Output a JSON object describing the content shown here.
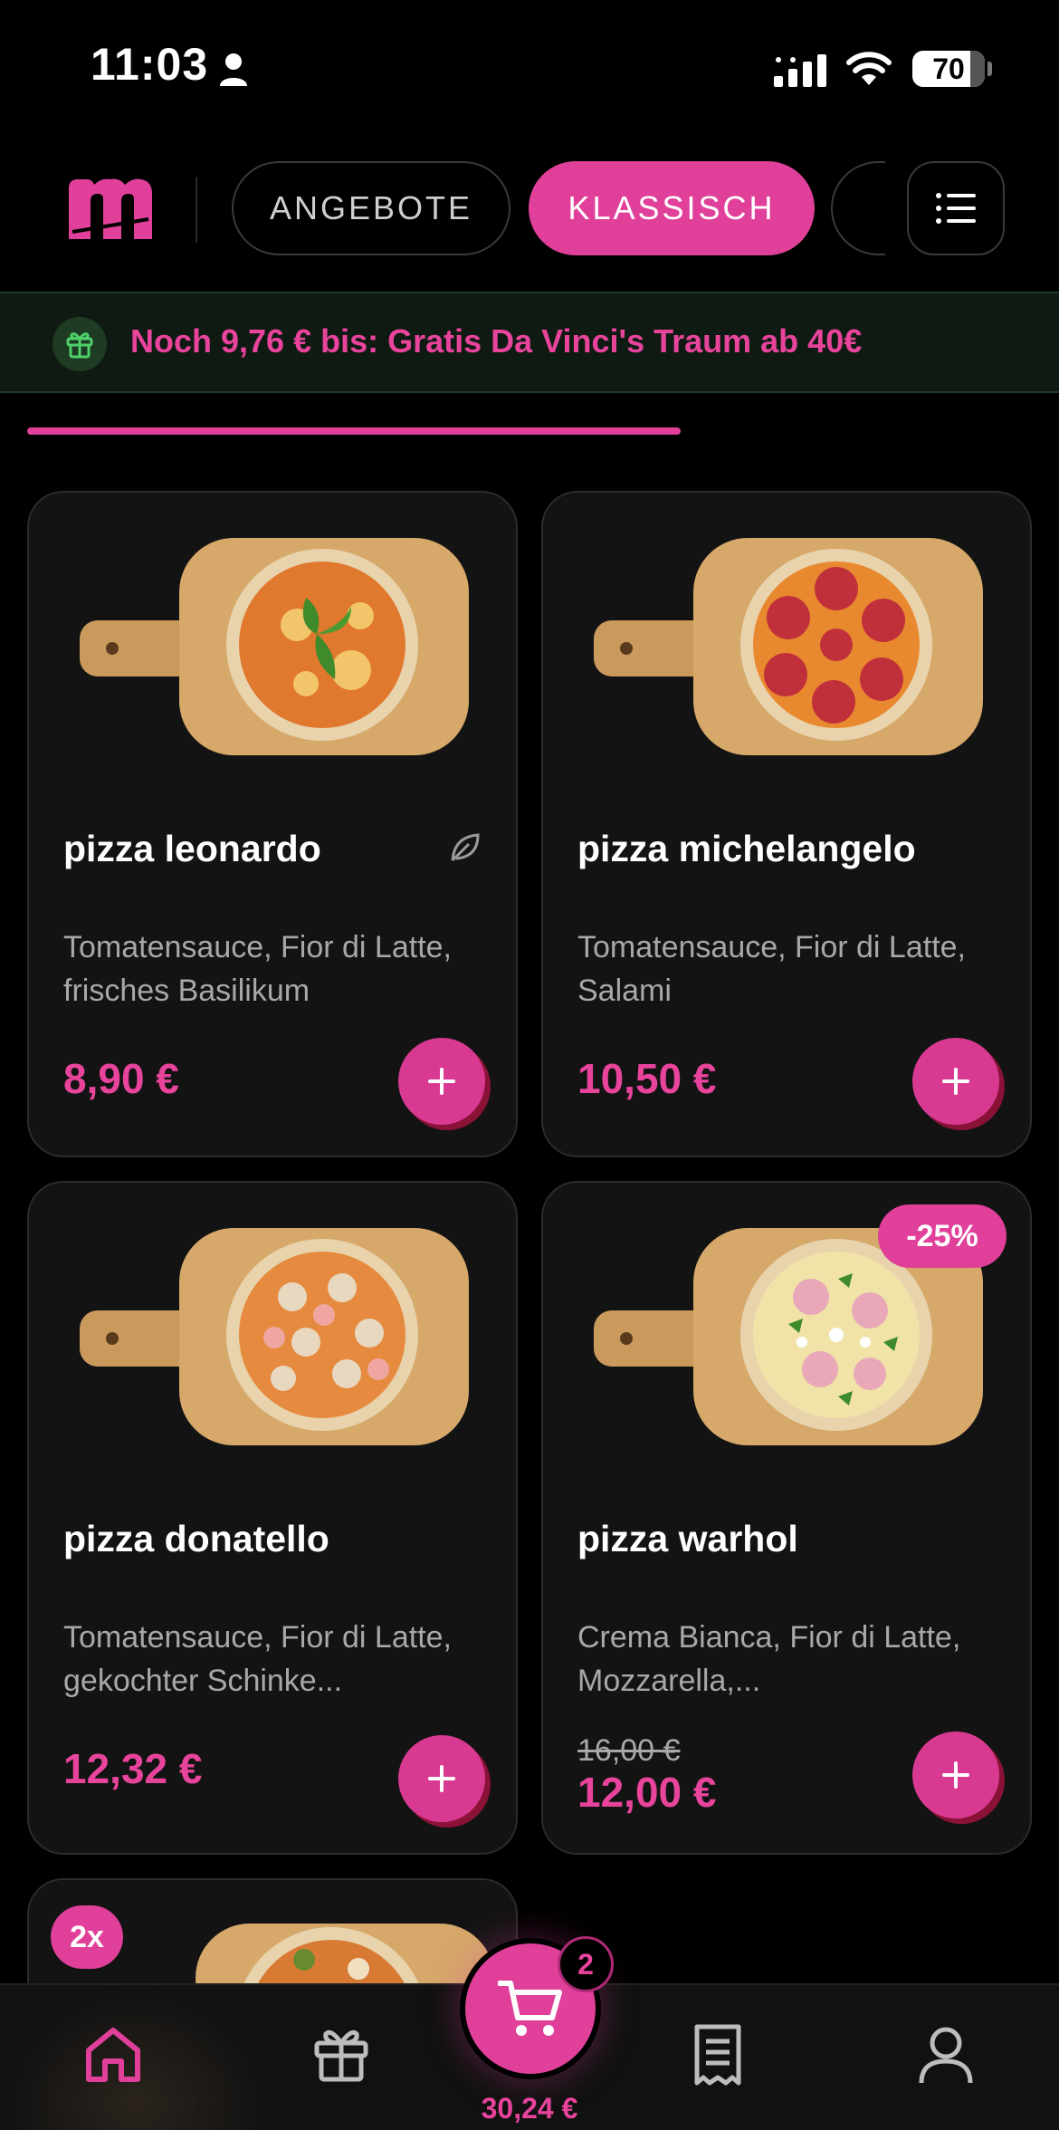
{
  "status_bar": {
    "time": "11:03",
    "battery": "70"
  },
  "nav": {
    "logo": "m",
    "tabs": [
      {
        "label": "ANGEBOTE"
      },
      {
        "label": "KLASSISCH",
        "active": true
      }
    ]
  },
  "promo": {
    "text": "Noch 9,76 € bis: Gratis Da Vinci's Traum ab 40€"
  },
  "progress": {
    "fraction": 0.65
  },
  "products": [
    {
      "name": "pizza leonardo",
      "desc": "Tomatensauce, Fior di Latte, frisches Basilikum",
      "price": "8,90 €",
      "vegetarian": true
    },
    {
      "name": "pizza michelangelo",
      "desc": "Tomatensauce, Fior di Latte, Salami",
      "price": "10,50 €"
    },
    {
      "name": "pizza donatello",
      "desc": "Tomatensauce, Fior di Latte, gekochter Schinke...",
      "price": "12,32 €"
    },
    {
      "name": "pizza warhol",
      "desc": "Crema Bianca, Fior di Latte, Mozzarella,...",
      "old_price": "16,00 €",
      "price": "12,00 €",
      "badge": "-25%"
    }
  ],
  "partial_card": {
    "badge": "2x"
  },
  "cart": {
    "count": "2",
    "total": "30,24 €"
  },
  "colors": {
    "accent": "#e0409a",
    "background": "#000000",
    "card": "#131313",
    "promo_bg": "#0f1a12"
  },
  "icons": [
    "person-icon",
    "signal-icon",
    "wifi-icon",
    "menu-list-icon",
    "gift-icon",
    "leaf-icon",
    "plus-icon",
    "home-icon",
    "rewards-icon",
    "receipt-icon",
    "profile-icon",
    "cart-icon"
  ]
}
